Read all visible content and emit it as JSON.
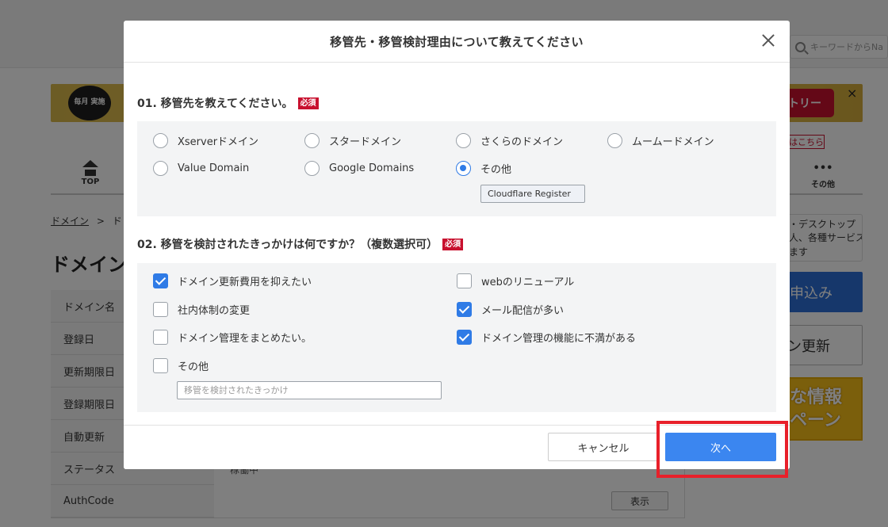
{
  "background": {
    "search_placeholder": "キーワードからNa",
    "banner_badge": "毎月 実施",
    "banner_entry": "トリー",
    "banner_close": "×",
    "banner_link": "はこちら",
    "nav_top": "TOP",
    "nav_other": "その他",
    "nav_other_dots": "•••",
    "breadcrumb_home": "ドメイン",
    "breadcrumb_sep": ">",
    "breadcrumb_current": "ド",
    "page_title": "ドメイン",
    "info_lines": [
      "・デスクトップ",
      "人、各種サービス",
      "ます"
    ],
    "apply_label": "申込み",
    "renew_label": "ン更新",
    "promo_line1": "な情報",
    "promo_line2": "ペーン",
    "table_labels": [
      "ドメイン名",
      "登録日",
      "更新期限日",
      "登録期限日",
      "自動更新",
      "ステータス",
      "AuthCode"
    ],
    "status_value": "稼働中",
    "show_button": "表示"
  },
  "modal": {
    "title": "移管先・移管検討理由について教えてください",
    "q1": {
      "title": "01. 移管先を教えてください。",
      "required": "必須",
      "options": [
        "Xserverドメイン",
        "スタードメイン",
        "さくらのドメイン",
        "ムームードメイン",
        "Value Domain",
        "Google Domains",
        "その他"
      ],
      "selected": "その他",
      "other_value": "Cloudflare Register"
    },
    "q2": {
      "title": "02. 移管を検討されたきっかけは何ですか？（複数選択可）",
      "required": "必須",
      "options": [
        {
          "label": "ドメイン更新費用を抑えたい",
          "checked": true
        },
        {
          "label": "webのリニューアル",
          "checked": false
        },
        {
          "label": "社内体制の変更",
          "checked": false
        },
        {
          "label": "メール配信が多い",
          "checked": true
        },
        {
          "label": "ドメイン管理をまとめたい。",
          "checked": false
        },
        {
          "label": "ドメイン管理の機能に不満がある",
          "checked": true
        },
        {
          "label": "その他",
          "checked": false
        }
      ],
      "reason_placeholder": "移管を検討されたきっかけ"
    },
    "cancel_label": "キャンセル",
    "next_label": "次へ"
  },
  "colors": {
    "accent": "#3b86f0",
    "required_badge": "#c8102e",
    "highlight": "#e8202a"
  }
}
